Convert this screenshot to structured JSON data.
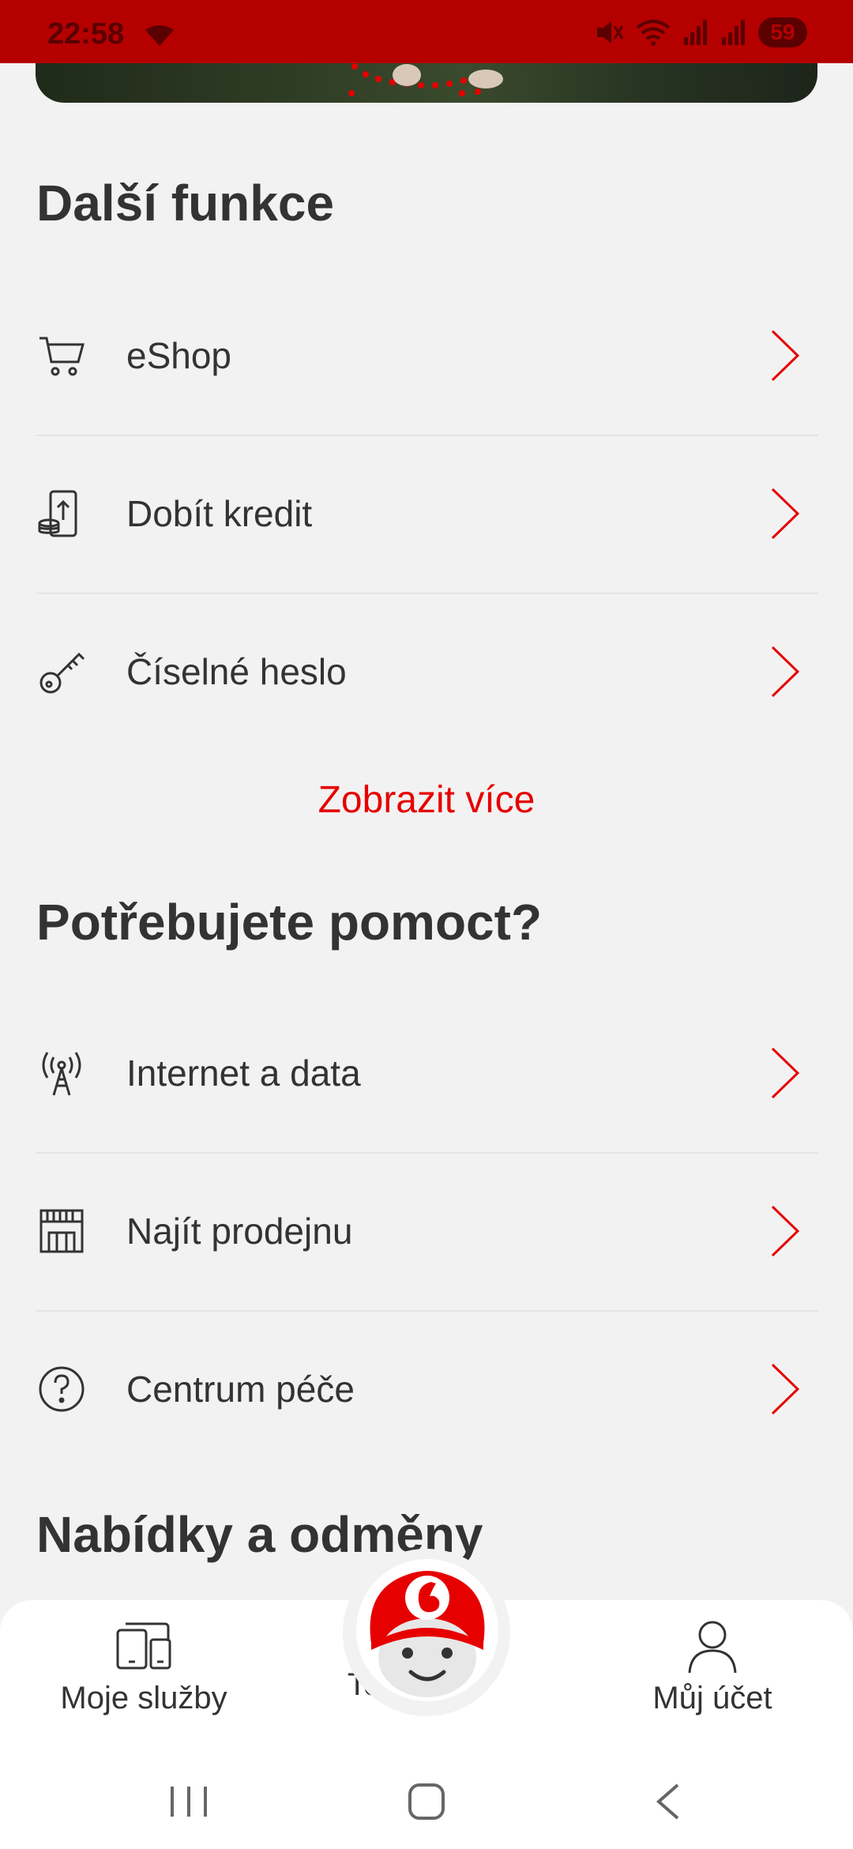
{
  "status_bar": {
    "time": "22:58",
    "battery": "59"
  },
  "sections": {
    "more_features": {
      "title": "Další funkce",
      "items": [
        {
          "label": "eShop",
          "icon": "cart-icon"
        },
        {
          "label": "Dobít kredit",
          "icon": "phone-topup-icon"
        },
        {
          "label": "Číselné heslo",
          "icon": "key-icon"
        }
      ],
      "show_more": "Zobrazit více"
    },
    "need_help": {
      "title": "Potřebujete pomoct?",
      "items": [
        {
          "label": "Internet a data",
          "icon": "antenna-icon"
        },
        {
          "label": "Najít prodejnu",
          "icon": "store-icon"
        },
        {
          "label": "Centrum péče",
          "icon": "help-circle-icon"
        }
      ]
    },
    "offers": {
      "title": "Nabídky a odměny"
    }
  },
  "bottom_nav": {
    "my_services": "Moje služby",
    "center_partial": "To",
    "my_account": "Můj účet"
  },
  "colors": {
    "accent": "#e60000",
    "status_bar": "#b50000",
    "background": "#f3f2f2"
  }
}
